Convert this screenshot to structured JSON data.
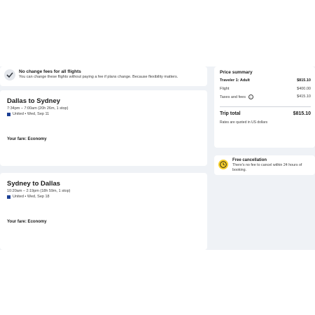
{
  "banner": {
    "title": "No change fees for all flights",
    "subtitle": "You can change these flights without paying a fee if plans change. Because flexibility matters."
  },
  "flights": [
    {
      "route": "Dallas to Sydney",
      "times": "7:34pm – 7:00am (20h 26m, 1 stop)",
      "airline_date": "United • Wed, Sep 11",
      "fare": "Your fare: Economy"
    },
    {
      "route": "Sydney to Dallas",
      "times": "10:20am – 2:19pm (18h 59m, 1 stop)",
      "airline_date": "United • Wed, Sep 18",
      "fare": "Your fare: Economy"
    }
  ],
  "summary": {
    "title": "Price summary",
    "traveler_label": "Traveler 1: Adult",
    "traveler_value": "$815.10",
    "flight_label": "Flight",
    "flight_value": "$400.00",
    "taxes_label": "Taxes and fees",
    "taxes_value": "$415.10",
    "total_label": "Trip total",
    "total_value": "$815.10",
    "note": "Rates are quoted in US dollars"
  },
  "cancellation": {
    "title": "Free cancellation",
    "subtitle": "There's no fee to cancel within 24 hours of booking."
  },
  "icons": {
    "banner": "checkmark-icon",
    "airline": "united-logo-icon",
    "info": "info-icon",
    "clock": "clock-icon"
  },
  "colors": {
    "background": "#eff2f6",
    "clock_yellow": "#f7cf2b",
    "airline_blue": "#1c3f94"
  }
}
